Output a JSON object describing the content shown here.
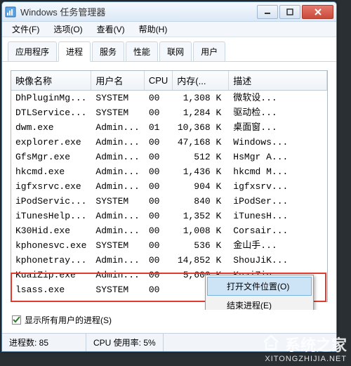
{
  "window": {
    "title": "Windows 任务管理器"
  },
  "menu": {
    "file": "文件(F)",
    "options": "选项(O)",
    "view": "查看(V)",
    "help": "帮助(H)"
  },
  "tabs": {
    "apps": "应用程序",
    "processes": "进程",
    "services": "服务",
    "performance": "性能",
    "network": "联网",
    "users": "用户"
  },
  "columns": {
    "image": "映像名称",
    "user": "用户名",
    "cpu": "CPU",
    "mem": "内存(...",
    "desc": "描述"
  },
  "rows": [
    {
      "img": "DhPluginMg...",
      "user": "SYSTEM",
      "cpu": "00",
      "mem": "1,308 K",
      "desc": "微软设..."
    },
    {
      "img": "DTLService...",
      "user": "SYSTEM",
      "cpu": "00",
      "mem": "1,284 K",
      "desc": "驱动检..."
    },
    {
      "img": "dwm.exe",
      "user": "Admin...",
      "cpu": "01",
      "mem": "10,368 K",
      "desc": "桌面窗..."
    },
    {
      "img": "explorer.exe",
      "user": "Admin...",
      "cpu": "00",
      "mem": "47,168 K",
      "desc": "Windows..."
    },
    {
      "img": "GfsMgr.exe",
      "user": "Admin...",
      "cpu": "00",
      "mem": "512 K",
      "desc": "HsMgr A..."
    },
    {
      "img": "hkcmd.exe",
      "user": "Admin...",
      "cpu": "00",
      "mem": "1,436 K",
      "desc": "hkcmd M..."
    },
    {
      "img": "igfxsrvc.exe",
      "user": "Admin...",
      "cpu": "00",
      "mem": "904 K",
      "desc": "igfxsrv..."
    },
    {
      "img": "iPodServic...",
      "user": "SYSTEM",
      "cpu": "00",
      "mem": "840 K",
      "desc": "iPodSer..."
    },
    {
      "img": "iTunesHelp...",
      "user": "Admin...",
      "cpu": "00",
      "mem": "1,352 K",
      "desc": "iTunesH..."
    },
    {
      "img": "K30Hid.exe",
      "user": "Admin...",
      "cpu": "00",
      "mem": "1,008 K",
      "desc": "Corsair..."
    },
    {
      "img": "kphonesvc.exe",
      "user": "SYSTEM",
      "cpu": "00",
      "mem": "536 K",
      "desc": "金山手..."
    },
    {
      "img": "kphonetray...",
      "user": "Admin...",
      "cpu": "00",
      "mem": "14,852 K",
      "desc": "ShouJiK..."
    },
    {
      "img": "KuaiZip.exe",
      "user": "Admin...",
      "cpu": "00",
      "mem": "5,600 K",
      "desc": "KuaiZip..."
    },
    {
      "img": "lsass.exe",
      "user": "SYSTEM",
      "cpu": "00",
      "mem": "",
      "desc": ""
    }
  ],
  "context_menu": {
    "open_location": "打开文件位置(O)",
    "end_process": "结束进程(E)"
  },
  "bottom": {
    "show_all_users": "显示所有用户的进程(S)"
  },
  "status": {
    "proc_label": "进程数: 85",
    "cpu_label": "CPU 使用率: 5%"
  },
  "watermark": {
    "main": "系统之家",
    "sub": "XITONGZHIJIA.NET"
  }
}
